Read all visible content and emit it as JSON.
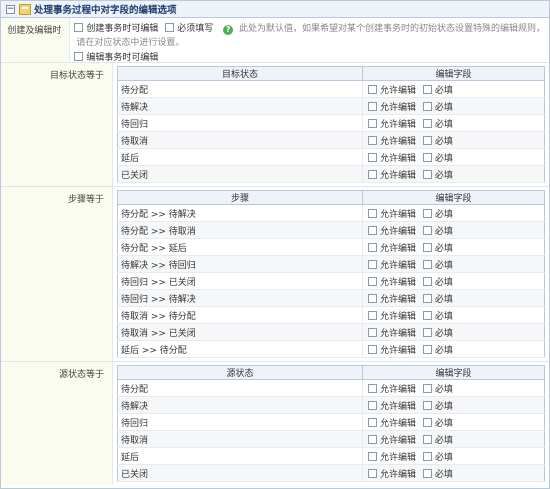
{
  "section": {
    "title": "处理事务过程中对字段的编辑选项",
    "toggle": "−"
  },
  "create_row": {
    "label": "创建及编辑时",
    "opt_allow": "创建事务时可编辑",
    "opt_required": "必须填写",
    "help": "?",
    "hint": "此处为默认值，如果希望对某个创建事务时的初始状态设置特殊的编辑规则，",
    "hint2": "请在对应状态中进行设置。",
    "opt_edit": "编辑事务时可编辑"
  },
  "target_state": {
    "label": "目标状态等于",
    "col1": "目标状态",
    "col2": "编辑字段",
    "allow": "允许编辑",
    "required": "必填",
    "rows": [
      "待分配",
      "待解决",
      "待回归",
      "待取消",
      "延后",
      "已关闭"
    ]
  },
  "step": {
    "label": "步骤等于",
    "col1": "步骤",
    "col2": "编辑字段",
    "allow": "允许编辑",
    "required": "必填",
    "rows": [
      "待分配 >> 待解决",
      "待分配 >> 待取消",
      "待分配 >> 延后",
      "待解决 >> 待回归",
      "待回归 >> 已关闭",
      "待回归 >> 待解决",
      "待取消 >> 待分配",
      "待取消 >> 已关闭",
      "延后 >> 待分配"
    ]
  },
  "source_state": {
    "label": "源状态等于",
    "col1": "源状态",
    "col2": "编辑字段",
    "allow": "允许编辑",
    "required": "必填",
    "rows": [
      "待分配",
      "待解决",
      "待回归",
      "待取消",
      "延后",
      "已关闭"
    ]
  }
}
